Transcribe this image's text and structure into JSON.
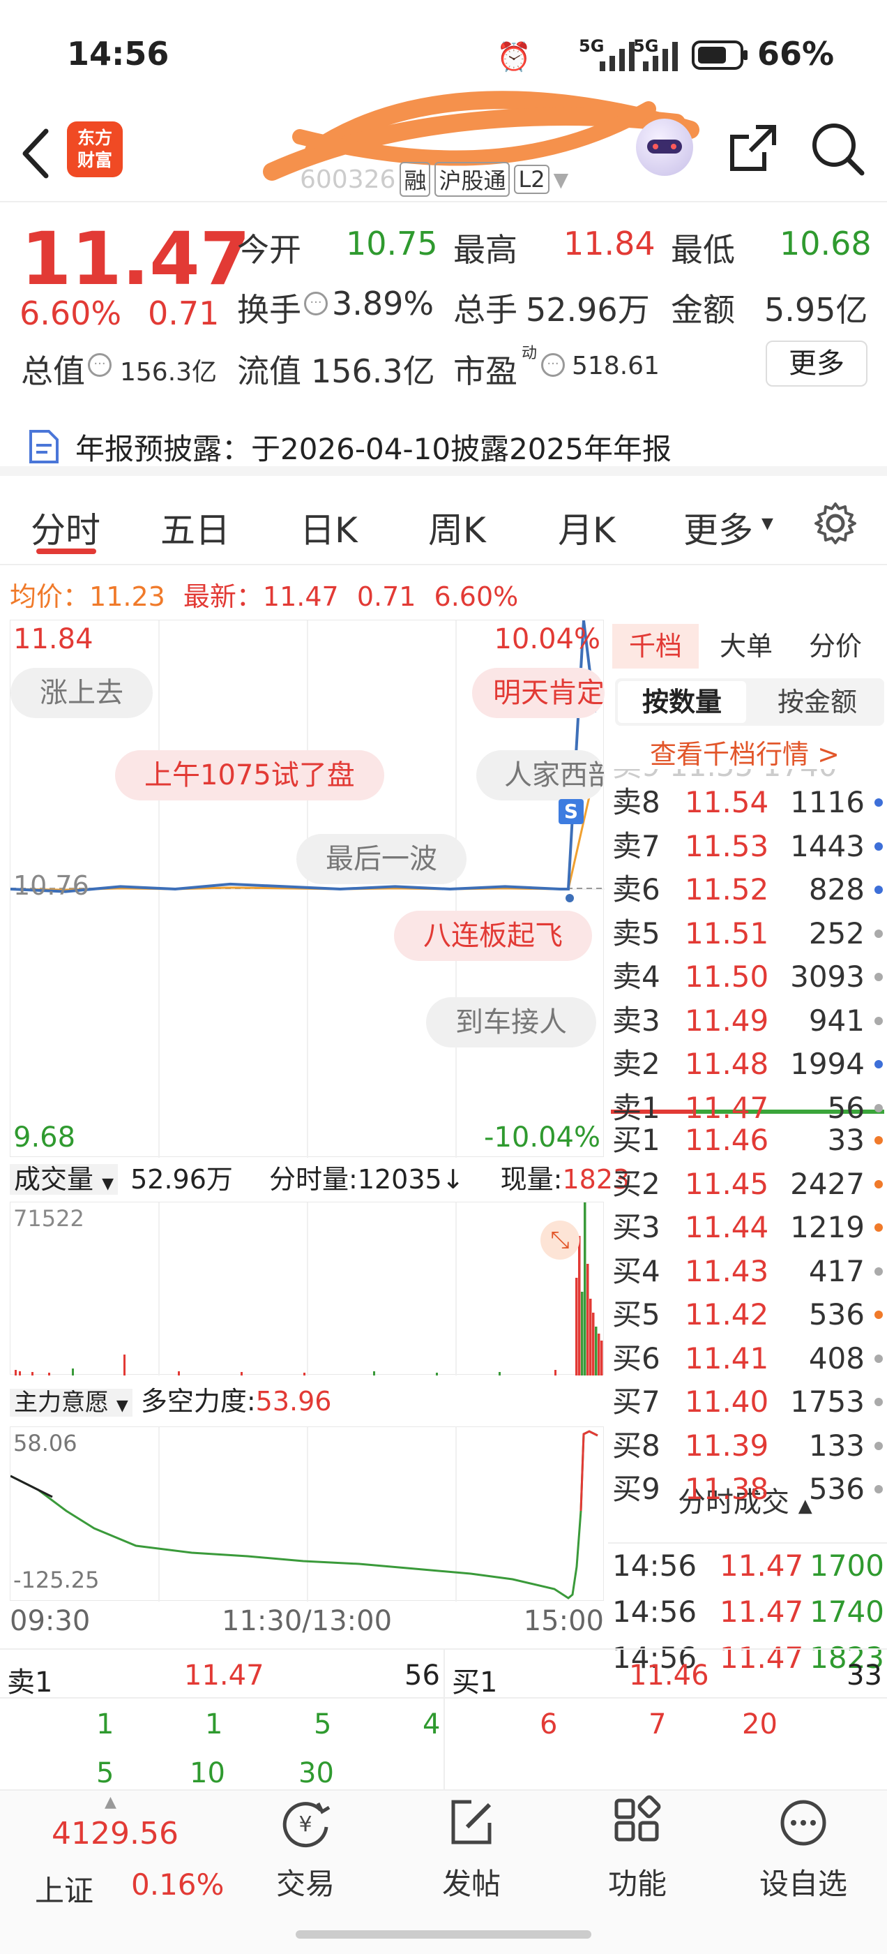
{
  "status": {
    "time": "14:56",
    "battery": "66%",
    "net1": "5G",
    "net2": "5G"
  },
  "header": {
    "logo_text": "东方\n财富",
    "stock_code": "600326",
    "tags": [
      "融",
      "沪股通",
      "L2"
    ]
  },
  "quote": {
    "price": "11.47",
    "pct": "6.60%",
    "chg": "0.71",
    "open_label": "今开",
    "open": "10.75",
    "high_label": "最高",
    "high": "11.84",
    "low_label": "最低",
    "low": "10.68",
    "turnover_label": "换手",
    "turnover": "3.89%",
    "volume_label": "总手",
    "volume": "52.96万",
    "amount_label": "金额",
    "amount": "5.95亿",
    "mktcap_label": "总值",
    "mktcap": "156.3亿",
    "float_label": "流值",
    "float": "156.3亿",
    "pe_label": "市盈",
    "pe_sup": "动",
    "pe": "518.61",
    "more_button": "更多"
  },
  "notice": {
    "text": "年报预披露：于2026-04-10披露2025年年报"
  },
  "tabs": [
    "分时",
    "五日",
    "日K",
    "周K",
    "月K",
    "更多"
  ],
  "avgline": {
    "avg_label": "均价：",
    "avg": "11.23",
    "latest_label": "最新：",
    "latest": "11.47",
    "chg": "0.71",
    "pct": "6.60%"
  },
  "chart": {
    "top_price": "11.84",
    "top_pct": "10.04%",
    "bottom_price": "9.68",
    "bottom_pct": "-10.04%",
    "ref_price": "10.76",
    "comments": [
      "涨上去",
      "明天肯定",
      "上午1075试了盘",
      "人家西部",
      "最后一波",
      "八连板起飞",
      "到车接人"
    ],
    "s_badge": "S"
  },
  "chart_data": {
    "type": "line",
    "x": [
      "09:30",
      "11:30/13:00",
      "15:00"
    ],
    "ylim": [
      9.68,
      11.84
    ],
    "series": [
      {
        "values": [
          10.76,
          10.75,
          10.77,
          10.76,
          10.78,
          10.77,
          10.76,
          10.77,
          10.76,
          10.77,
          10.76,
          10.76,
          11.84,
          11.47
        ]
      }
    ]
  },
  "volume": {
    "label": "成交量",
    "total": "52.96万",
    "tick_label": "分时量:",
    "tick": "12035↓",
    "now_label": "现量:",
    "now": "1823",
    "max": "71522"
  },
  "indicator": {
    "label": "主力意愿",
    "ls_label": "多空力度:",
    "ls": "53.96",
    "max": "58.06",
    "min": "-125.25"
  },
  "xaxis": [
    "09:30",
    "11:30/13:00",
    "15:00"
  ],
  "orderbook": {
    "tabs": [
      "千档",
      "大单",
      "分价"
    ],
    "subtabs": [
      "按数量",
      "按金额"
    ],
    "link": "查看千档行情 >",
    "asks": [
      {
        "label": "卖8",
        "price": "11.54",
        "vol": "1116",
        "dot": "#3d6fd8"
      },
      {
        "label": "卖7",
        "price": "11.53",
        "vol": "1443",
        "dot": "#3d6fd8"
      },
      {
        "label": "卖6",
        "price": "11.52",
        "vol": "828",
        "dot": "#3d6fd8"
      },
      {
        "label": "卖5",
        "price": "11.51",
        "vol": "252",
        "dot": "#aaaaaa"
      },
      {
        "label": "卖4",
        "price": "11.50",
        "vol": "3093",
        "dot": "#aaaaaa"
      },
      {
        "label": "卖3",
        "price": "11.49",
        "vol": "941",
        "dot": "#aaaaaa"
      },
      {
        "label": "卖2",
        "price": "11.48",
        "vol": "1994",
        "dot": "#3d6fd8"
      },
      {
        "label": "卖1",
        "price": "11.47",
        "vol": "56",
        "dot": "#aaaaaa"
      }
    ],
    "bids": [
      {
        "label": "买1",
        "price": "11.46",
        "vol": "33",
        "dot": "#f07a2a"
      },
      {
        "label": "买2",
        "price": "11.45",
        "vol": "2427",
        "dot": "#f07a2a"
      },
      {
        "label": "买3",
        "price": "11.44",
        "vol": "1219",
        "dot": "#f07a2a"
      },
      {
        "label": "买4",
        "price": "11.43",
        "vol": "417",
        "dot": "#aaaaaa"
      },
      {
        "label": "买5",
        "price": "11.42",
        "vol": "536",
        "dot": "#f07a2a"
      },
      {
        "label": "买6",
        "price": "11.41",
        "vol": "408",
        "dot": "#aaaaaa"
      },
      {
        "label": "买7",
        "price": "11.40",
        "vol": "1753",
        "dot": "#aaaaaa"
      },
      {
        "label": "买8",
        "price": "11.39",
        "vol": "133",
        "dot": "#aaaaaa"
      },
      {
        "label": "买9",
        "price": "11.38",
        "vol": "536",
        "dot": "#aaaaaa"
      }
    ],
    "trades_title": "分时成交",
    "trades": [
      {
        "time": "14:56",
        "price": "11.47",
        "vol": "1700"
      },
      {
        "time": "14:56",
        "price": "11.47",
        "vol": "1740"
      },
      {
        "time": "14:56",
        "price": "11.47",
        "vol": "1823"
      }
    ]
  },
  "level1": {
    "sell_label": "卖1",
    "sell_price": "11.47",
    "sell_vol": "56",
    "buy_label": "买1",
    "buy_price": "11.46",
    "buy_vol": "33",
    "sell_queue": [
      "1",
      "1",
      "5",
      "4",
      "5",
      "10",
      "30"
    ],
    "buy_queue": [
      "6",
      "7",
      "20"
    ]
  },
  "bottom_nav": {
    "index_value": "4129.56",
    "index_name": "上证",
    "index_pct": "0.16%",
    "items": [
      "交易",
      "发帖",
      "功能",
      "设自选"
    ]
  }
}
